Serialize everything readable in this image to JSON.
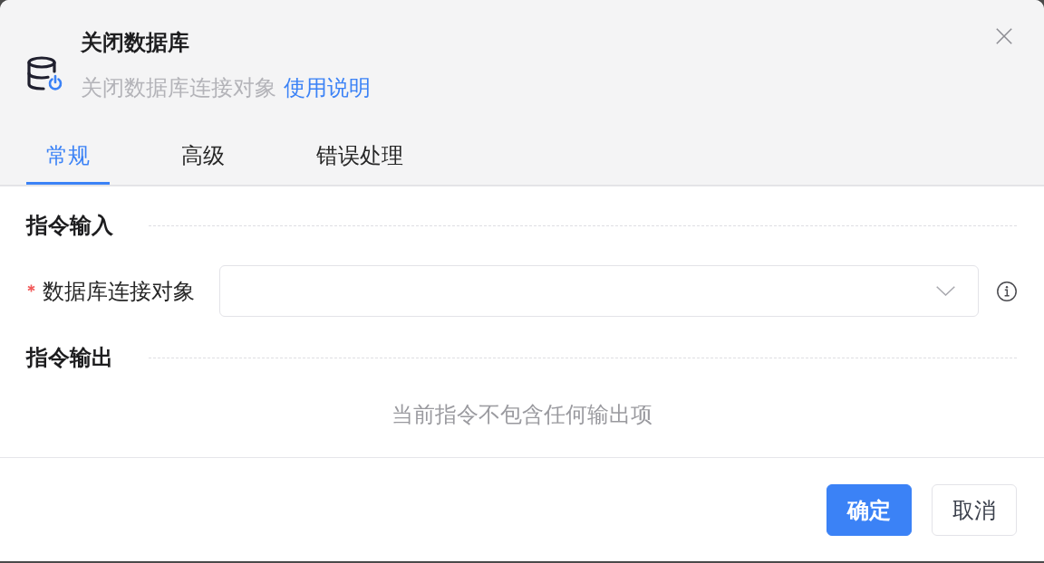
{
  "dialog": {
    "title": "关闭数据库",
    "description": "关闭数据库连接对象",
    "help_link": "使用说明"
  },
  "tabs": [
    {
      "label": "常规",
      "selected": true
    },
    {
      "label": "高级",
      "selected": false
    },
    {
      "label": "错误处理",
      "selected": false
    }
  ],
  "sections": [
    {
      "title": "指令输入",
      "fields": [
        {
          "label": "数据库连接对象",
          "required": true,
          "kind": "select"
        }
      ]
    },
    {
      "title": "指令输出",
      "empty_text": "当前指令不包含任何输出项"
    }
  ],
  "buttons": [
    {
      "label": "确定",
      "kind": "primary"
    },
    {
      "label": "取消",
      "kind": "default"
    }
  ]
}
